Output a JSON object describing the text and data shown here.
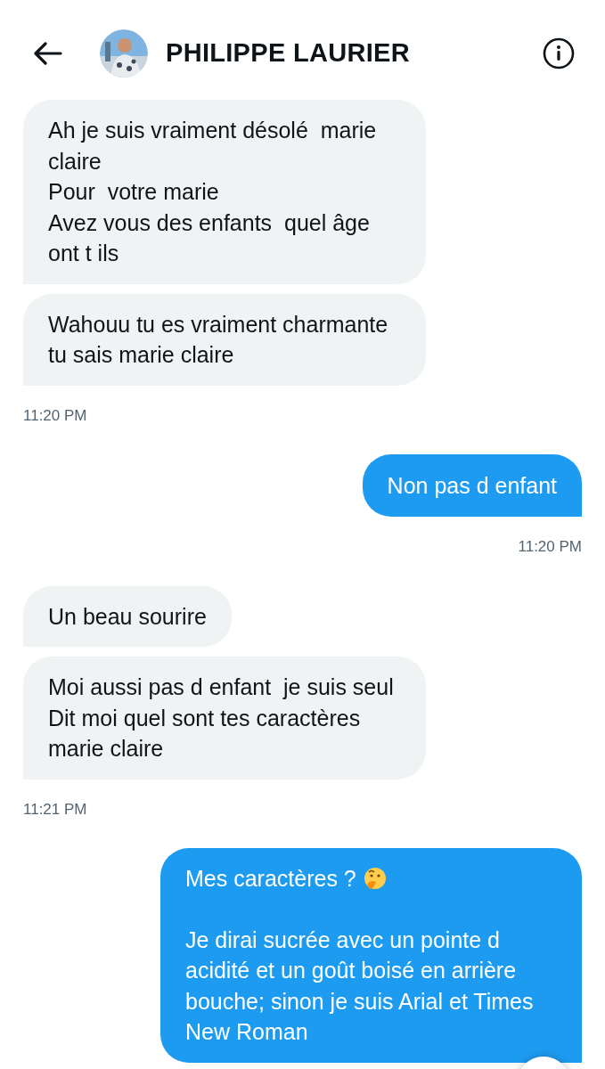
{
  "header": {
    "title": "PHILIPPE LAURIER"
  },
  "messages": [
    {
      "kind": "received",
      "text": "Ah je suis vraiment désolé  marie claire\nPour  votre marie\nAvez vous des enfants  quel âge ont t ils"
    },
    {
      "kind": "received",
      "text": "Wahouu tu es vraiment charmante tu sais marie claire"
    },
    {
      "kind": "time_received",
      "text": "11:20 PM"
    },
    {
      "kind": "sent",
      "text": "Non pas d enfant"
    },
    {
      "kind": "time_sent",
      "text": "11:20 PM"
    },
    {
      "kind": "received",
      "text": "Un beau sourire"
    },
    {
      "kind": "received",
      "text": "Moi aussi pas d enfant  je suis seul\nDit moi quel sont tes caractères marie claire"
    },
    {
      "kind": "time_received",
      "text": "11:21 PM"
    },
    {
      "kind": "sent",
      "text": "Mes caractères ?",
      "has_emoji": true,
      "rest": "Je dirai sucrée avec un pointe d acidité et un goût boisé en arrière bouche; sinon je suis Arial et Times New Roman"
    }
  ]
}
